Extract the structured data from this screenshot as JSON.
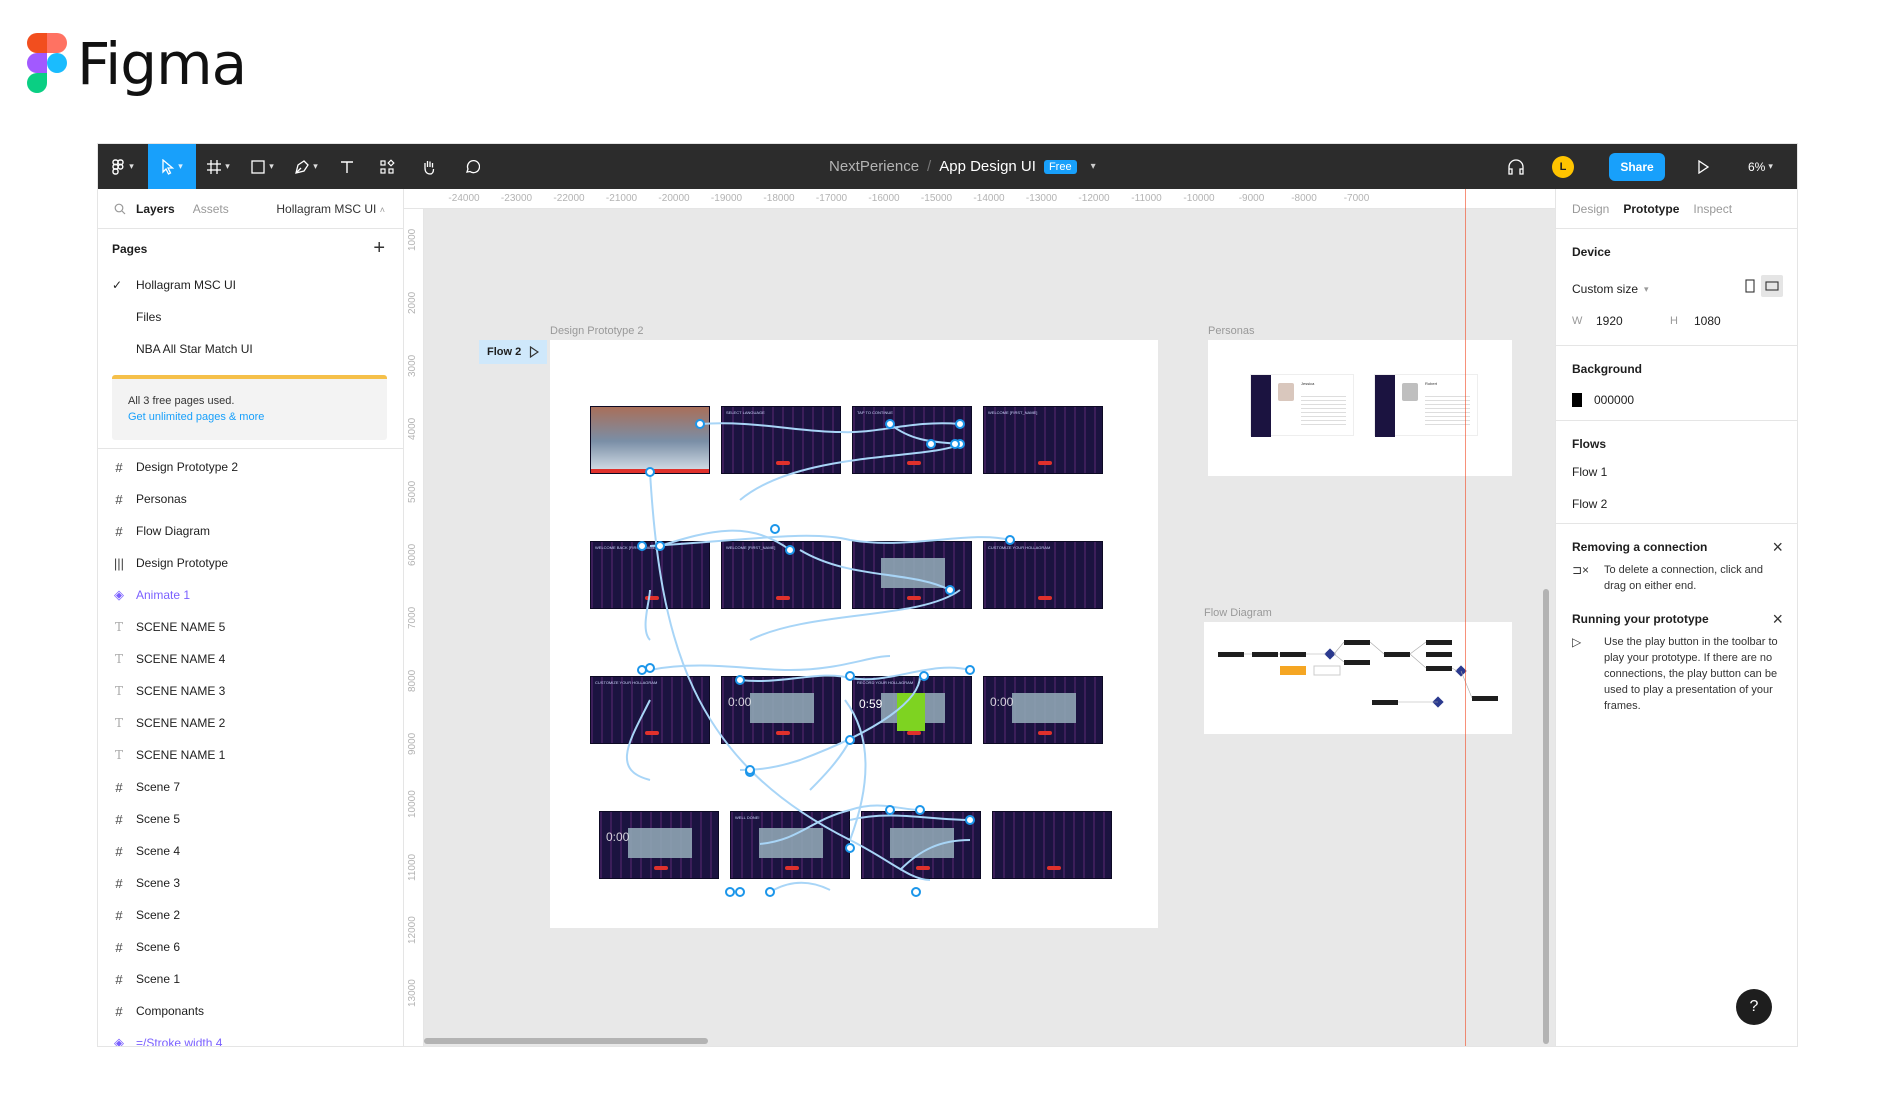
{
  "brand": {
    "name": "Figma",
    "colors": [
      "#f24e1e",
      "#ff7262",
      "#a259ff",
      "#1abcfe",
      "#0acf83"
    ]
  },
  "toolbar": {
    "tools": [
      {
        "name": "main-menu",
        "icon": "figma-menu-icon"
      },
      {
        "name": "move",
        "icon": "cursor-icon"
      },
      {
        "name": "frame",
        "icon": "frame-icon"
      },
      {
        "name": "shape",
        "icon": "rectangle-icon"
      },
      {
        "name": "pen",
        "icon": "pen-icon"
      },
      {
        "name": "text",
        "icon": "text-icon"
      },
      {
        "name": "resources",
        "icon": "components-icon"
      },
      {
        "name": "hand",
        "icon": "hand-icon"
      },
      {
        "name": "comment",
        "icon": "comment-icon"
      }
    ],
    "project": "NextPerience",
    "separator": "/",
    "file": "App Design UI",
    "plan_badge": "Free",
    "avatar_initial": "L",
    "share_label": "Share",
    "zoom": "6%",
    "accent": "#18a0fb"
  },
  "left_panel": {
    "tabs": [
      "Layers",
      "Assets"
    ],
    "current_page": "Hollagram MSC UI",
    "pages_title": "Pages",
    "pages": [
      "Hollagram MSC UI",
      "Files",
      "NBA All Star Match UI"
    ],
    "upgrade_text": "All 3 free pages used.",
    "upgrade_link": "Get unlimited pages & more",
    "layers": [
      {
        "label": "Design Prototype 2",
        "icon": "#"
      },
      {
        "label": "Personas",
        "icon": "#"
      },
      {
        "label": "Flow Diagram",
        "icon": "#"
      },
      {
        "label": "Design Prototype",
        "icon": "|||"
      },
      {
        "label": "Animate 1",
        "icon": "◈"
      },
      {
        "label": "SCENE NAME 5",
        "icon": "T"
      },
      {
        "label": "SCENE NAME 4",
        "icon": "T"
      },
      {
        "label": "SCENE NAME 3",
        "icon": "T"
      },
      {
        "label": "SCENE NAME 2",
        "icon": "T"
      },
      {
        "label": "SCENE NAME 1",
        "icon": "T"
      },
      {
        "label": "Scene 7",
        "icon": "#"
      },
      {
        "label": "Scene 5",
        "icon": "#"
      },
      {
        "label": "Scene 4",
        "icon": "#"
      },
      {
        "label": "Scene 3",
        "icon": "#"
      },
      {
        "label": "Scene 2",
        "icon": "#"
      },
      {
        "label": "Scene 6",
        "icon": "#"
      },
      {
        "label": "Scene 1",
        "icon": "#"
      },
      {
        "label": "Componants",
        "icon": "#"
      },
      {
        "label": "=/Stroke width 4",
        "icon": "◈"
      }
    ]
  },
  "canvas": {
    "ruler_x": [
      "-24000",
      "-23000",
      "-22000",
      "-21000",
      "-20000",
      "-19000",
      "-18000",
      "-17000",
      "-16000",
      "-15000",
      "-14000",
      "-13000",
      "-12000",
      "-11000",
      "-10000",
      "-9000",
      "-8000",
      "-7000"
    ],
    "ruler_y": [
      "1000",
      "2000",
      "3000",
      "4000",
      "5000",
      "6000",
      "7000",
      "8000",
      "9000",
      "10000",
      "11000",
      "12000",
      "13000"
    ],
    "frames": {
      "design_prototype_2": "Design Prototype 2",
      "personas": "Personas",
      "flow_diagram": "Flow Diagram"
    },
    "flow_tag": "Flow 2",
    "scene_titles": [
      "",
      "SELECT LANGUAGE",
      "TAP TO CONTINUE",
      "WELCOME [FIRST_NAME]",
      "WELCOME BACK [FIRST_NAME]",
      "WELCOME [FIRST_NAME]",
      "",
      "CUSTOMIZE YOUR HOLLAGRAM",
      "CUSTOMIZE YOUR HOLLAGRAM",
      "",
      "RECORD YOUR HOLLAGRAM",
      "",
      "",
      "WELL DONE!",
      "",
      ""
    ],
    "timer_a": "0:59",
    "timer_b": "0:00",
    "persona_names": [
      "Jessica",
      "Robert"
    ]
  },
  "right_panel": {
    "tabs": [
      "Design",
      "Prototype",
      "Inspect"
    ],
    "device_title": "Device",
    "device_value": "Custom size",
    "w_label": "W",
    "w_value": "1920",
    "h_label": "H",
    "h_value": "1080",
    "background_title": "Background",
    "background_value": "000000",
    "flows_title": "Flows",
    "flows": [
      "Flow 1",
      "Flow 2"
    ],
    "removing_title": "Removing a connection",
    "removing_text": "To delete a connection, click and drag on either end.",
    "running_title": "Running your prototype",
    "running_text": "Use the play button in the toolbar to play your prototype. If there are no connections, the play button can be used to play a presentation of your frames."
  },
  "help_label": "?"
}
